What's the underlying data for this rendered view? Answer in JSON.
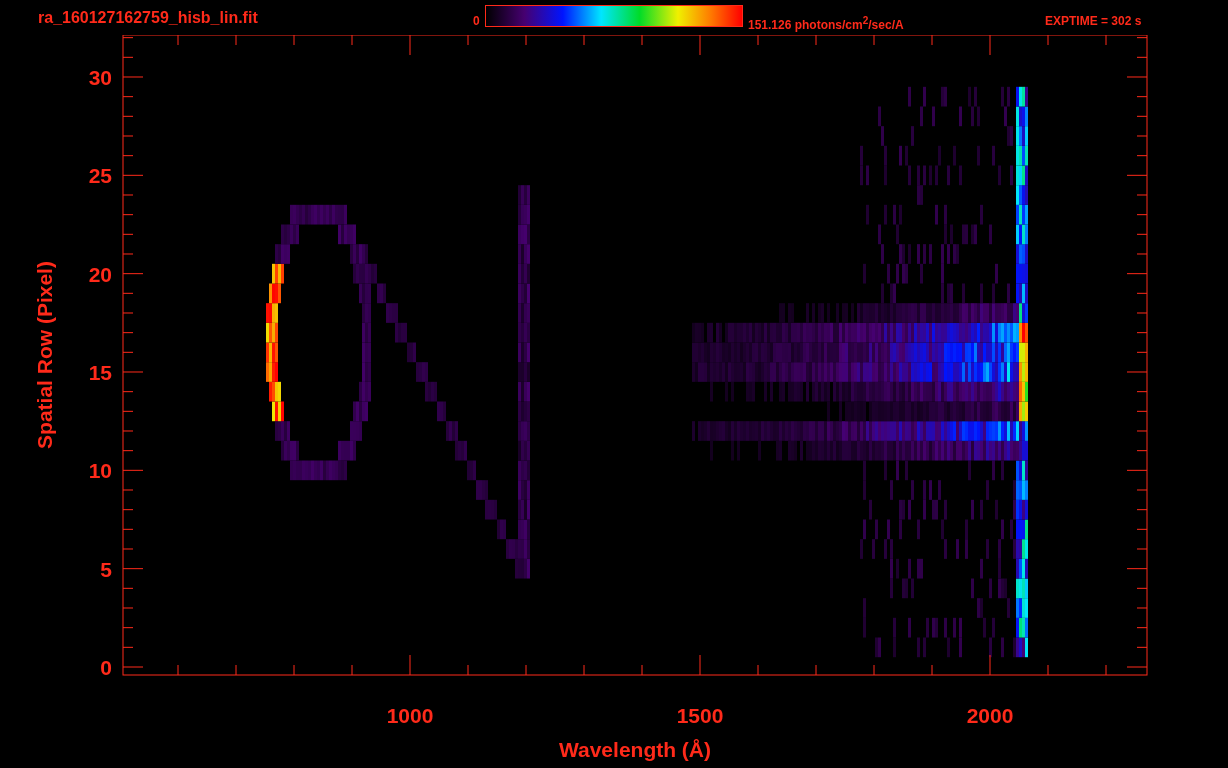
{
  "header": {
    "file_name": "ra_160127162759_hisb_lin.fit",
    "colorbar": {
      "min_label": "0",
      "max_label": "151.126 photons/cm$^{2}$/sec/A"
    },
    "exposure": "EXPTIME = 302 s"
  },
  "plot": {
    "xlabel": "Wavelength (Å)",
    "ylabel": "Spatial Row (Pixel)",
    "x_tick_labels": [
      "1000",
      "1500",
      "2000"
    ],
    "y_tick_labels": [
      "30",
      "25",
      "20",
      "15",
      "10",
      "5",
      "0"
    ]
  }
}
